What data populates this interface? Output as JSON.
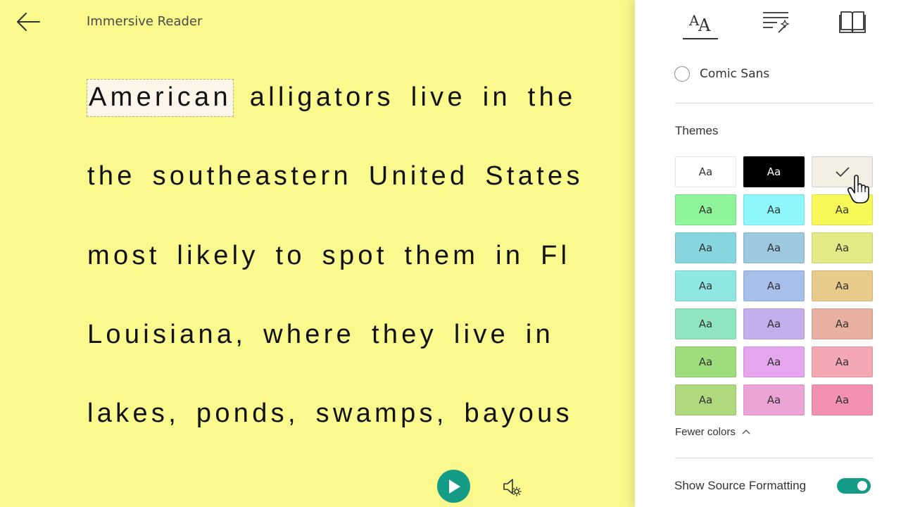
{
  "app": {
    "title": "Immersive Reader"
  },
  "document": {
    "highlighted_word": "American",
    "lines": [
      "alligators live in the",
      "the southeastern United States",
      "most likely to spot them in Fl",
      "Louisiana, where they live in",
      "lakes, ponds, swamps, bayous"
    ]
  },
  "icons": {
    "back": "back-arrow-icon",
    "play": "play-icon",
    "voice_settings": "voice-settings-icon",
    "text_preferences": "text-preferences-icon",
    "grammar_options": "grammar-options-icon",
    "reading_preferences": "reading-preferences-icon",
    "chevron": "chevron-up-icon",
    "cursor": "hand-cursor-icon"
  },
  "panel": {
    "font_option": "Comic Sans",
    "themes_title": "Themes",
    "themes": [
      {
        "label": "Aa",
        "color": "#ffffff"
      },
      {
        "label": "Aa",
        "color": "#000000"
      },
      {
        "label": "",
        "color": "#f3efe2",
        "selected": true
      },
      {
        "label": "Aa",
        "color": "#8ff59a"
      },
      {
        "label": "Aa",
        "color": "#8df7fb"
      },
      {
        "label": "Aa",
        "color": "#f6f957"
      },
      {
        "label": "Aa",
        "color": "#87d6df"
      },
      {
        "label": "Aa",
        "color": "#9cc9df"
      },
      {
        "label": "Aa",
        "color": "#e3e987"
      },
      {
        "label": "Aa",
        "color": "#8ee7e3"
      },
      {
        "label": "Aa",
        "color": "#a8bfec"
      },
      {
        "label": "Aa",
        "color": "#e8cb8b"
      },
      {
        "label": "Aa",
        "color": "#8fe5bd"
      },
      {
        "label": "Aa",
        "color": "#c5aeec"
      },
      {
        "label": "Aa",
        "color": "#e8b0a0"
      },
      {
        "label": "Aa",
        "color": "#9edd7c"
      },
      {
        "label": "Aa",
        "color": "#e6a5ef"
      },
      {
        "label": "Aa",
        "color": "#f4a8b3"
      },
      {
        "label": "Aa",
        "color": "#b0d87c"
      },
      {
        "label": "Aa",
        "color": "#eca4d6"
      },
      {
        "label": "Aa",
        "color": "#f291b2"
      }
    ],
    "fewer_colors_label": "Fewer colors",
    "show_source_formatting_label": "Show Source Formatting",
    "show_source_formatting": true
  },
  "colors": {
    "reader_background": "#f9f98e",
    "accent": "#159c86"
  }
}
